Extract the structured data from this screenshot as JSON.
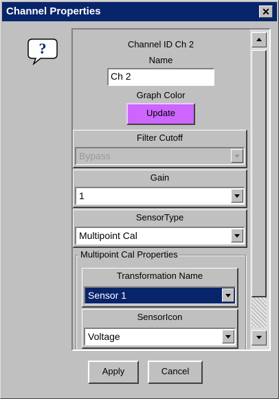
{
  "window": {
    "title": "Channel Properties",
    "close_label": "✕"
  },
  "help": {
    "glyph": "?"
  },
  "channel": {
    "id_label": "Channel ID Ch 2",
    "name_label": "Name",
    "name_value": "Ch 2",
    "graph_color_label": "Graph Color",
    "update_label": "Update",
    "update_color": "#cc66ff"
  },
  "filter": {
    "label": "Filter Cutoff",
    "value": "Bypass"
  },
  "gain": {
    "label": "Gain",
    "value": "1"
  },
  "sensor_type": {
    "label": "SensorType",
    "value": "Multipoint Cal"
  },
  "multipoint": {
    "legend": "Multipoint Cal Properties",
    "transformation_label": "Transformation Name",
    "transformation_value": "Sensor 1",
    "sensor_icon_label": "SensorIcon",
    "sensor_icon_value": "Voltage"
  },
  "buttons": {
    "apply": "Apply",
    "cancel": "Cancel"
  },
  "colors": {
    "titlebar": "#08246b",
    "selection": "#08246b",
    "face": "#c0c0c0"
  }
}
